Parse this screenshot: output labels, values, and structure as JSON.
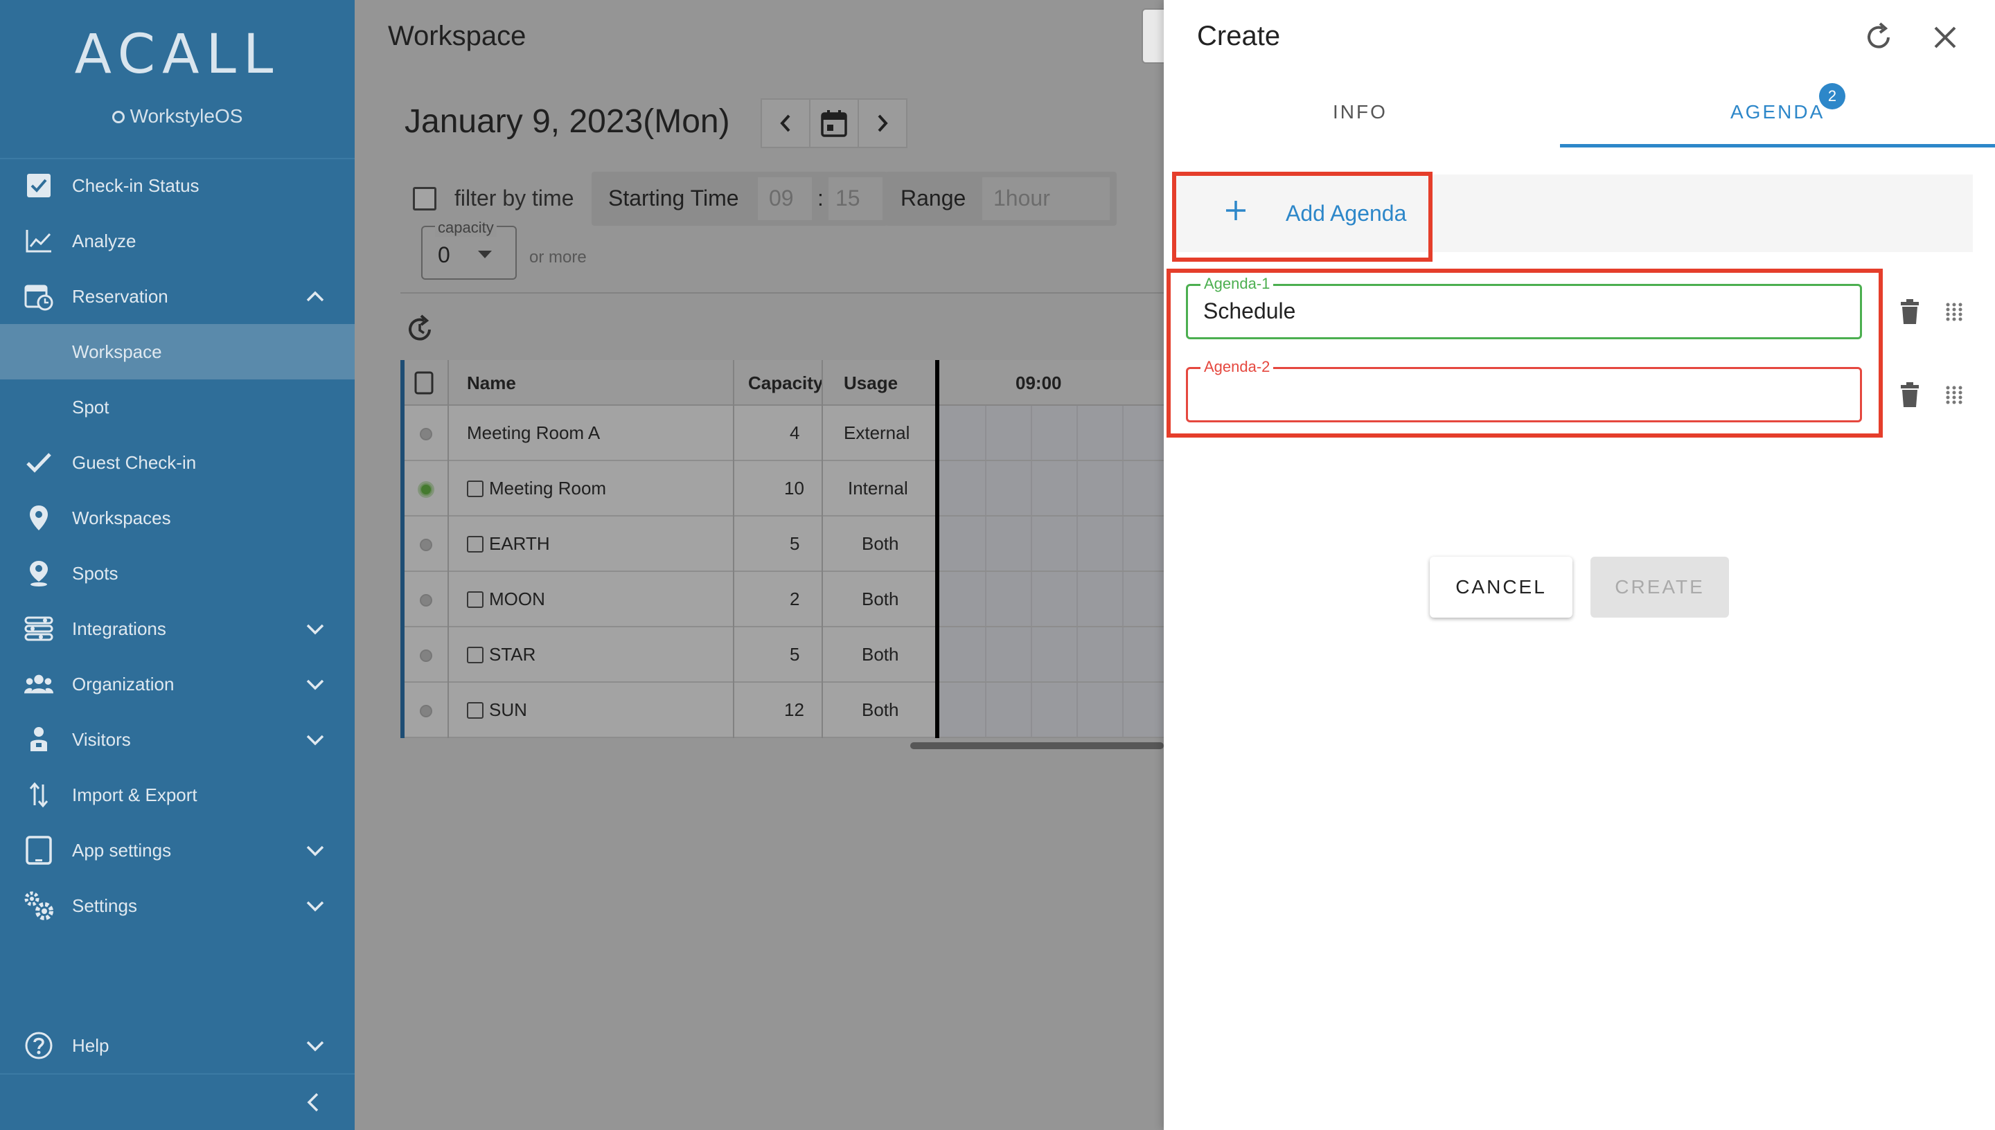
{
  "sidebar": {
    "logo": "ACALL",
    "subtitle": "WorkstyleOS",
    "items": [
      {
        "label": "Check-in Status",
        "icon": "checkbox-icon"
      },
      {
        "label": "Analyze",
        "icon": "chart-icon"
      },
      {
        "label": "Reservation",
        "icon": "calendar-clock-icon",
        "expanded": true
      },
      {
        "label": "Workspace",
        "active": true
      },
      {
        "label": "Spot"
      },
      {
        "label": "Guest Check-in",
        "icon": "check-icon"
      },
      {
        "label": "Workspaces",
        "icon": "location-pin-icon"
      },
      {
        "label": "Spots",
        "icon": "person-pin-icon"
      },
      {
        "label": "Integrations",
        "icon": "integrations-icon"
      },
      {
        "label": "Organization",
        "icon": "people-icon"
      },
      {
        "label": "Visitors",
        "icon": "visitor-icon"
      },
      {
        "label": "Import & Export",
        "icon": "import-export-icon"
      },
      {
        "label": "App settings",
        "icon": "tablet-icon"
      },
      {
        "label": "Settings",
        "icon": "gears-icon"
      },
      {
        "label": "Help",
        "icon": "help-icon"
      }
    ]
  },
  "main": {
    "title": "Workspace",
    "date": "January 9, 2023(Mon)",
    "filter_label": "filter by time",
    "starting_time_label": "Starting Time",
    "hour": "09",
    "colon": ":",
    "minute": "15",
    "range_label": "Range",
    "range_value": "1hour",
    "capacity_label": "capacity",
    "capacity_value": "0",
    "or_more": "or more",
    "table": {
      "headers": [
        "Name",
        "Capacity",
        "Usage",
        "09:00"
      ],
      "rows": [
        {
          "name": "Meeting Room A",
          "capacity": "4",
          "usage": "External",
          "checkbox": false
        },
        {
          "name": "Meeting Room",
          "capacity": "10",
          "usage": "Internal",
          "checkbox": true,
          "active": true
        },
        {
          "name": "EARTH",
          "capacity": "5",
          "usage": "Both",
          "checkbox": true
        },
        {
          "name": "MOON",
          "capacity": "2",
          "usage": "Both",
          "checkbox": true
        },
        {
          "name": "STAR",
          "capacity": "5",
          "usage": "Both",
          "checkbox": true
        },
        {
          "name": "SUN",
          "capacity": "12",
          "usage": "Both",
          "checkbox": true
        }
      ]
    }
  },
  "panel": {
    "title": "Create",
    "tabs": [
      {
        "label": "INFO"
      },
      {
        "label": "AGENDA",
        "badge": "2",
        "active": true
      }
    ],
    "add_agenda_label": "Add Agenda",
    "agendas": [
      {
        "label": "Agenda-1",
        "value": "Schedule",
        "state": "valid"
      },
      {
        "label": "Agenda-2",
        "value": "",
        "state": "error"
      }
    ],
    "cancel_label": "CANCEL",
    "create_label": "CREATE"
  },
  "colors": {
    "sidebar_bg": "#2f6e99",
    "accent": "#2d87c9",
    "highlight": "#e53e2b",
    "valid": "#4caf50",
    "error": "#e5483f"
  }
}
